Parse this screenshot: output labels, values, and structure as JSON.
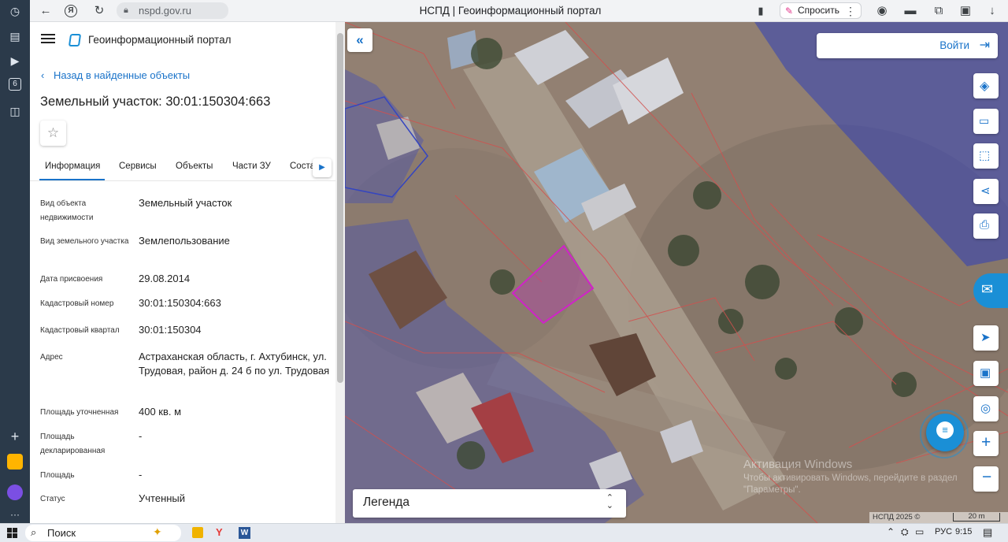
{
  "browser": {
    "url": "nspd.gov.ru",
    "tab_title": "НСПД | Геоинформационный портал",
    "ask_label": "Спросить",
    "rail_badge": "6"
  },
  "panel": {
    "portal_title": "Геоинформационный портал",
    "back_link": "Назад в найденные объекты",
    "object_title": "Земельный участок: 30:01:150304:663",
    "tabs": [
      "Информация",
      "Сервисы",
      "Объекты",
      "Части ЗУ",
      "Соста"
    ],
    "properties": [
      {
        "label": "Вид объекта недвижимости",
        "value": "Земельный участок"
      },
      {
        "label": "Вид земельного участка",
        "value": "Землепользование"
      },
      {
        "label": "Дата присвоения",
        "value": "29.08.2014"
      },
      {
        "label": "Кадастровый номер",
        "value": "30:01:150304:663"
      },
      {
        "label": "Кадастровый квартал",
        "value": "30:01:150304"
      },
      {
        "label": "Адрес",
        "value": "Астраханская область, г. Ахтубинск, ул. Трудовая, район д. 24 б по ул. Трудовая"
      },
      {
        "label": "Площадь уточненная",
        "value": "400 кв. м"
      },
      {
        "label": "Площадь декларированная",
        "value": "-"
      },
      {
        "label": "Площадь",
        "value": "-"
      },
      {
        "label": "Статус",
        "value": "Учтенный"
      }
    ]
  },
  "map": {
    "login_label": "Войти",
    "legend_label": "Легенда",
    "copyright": "НСПД 2025 ©",
    "scale_label": "20 m",
    "watermark_line1": "Активация Windows",
    "watermark_line2": "Чтобы активировать Windows, перейдите в раздел",
    "watermark_line3": "\"Параметры\"."
  },
  "taskbar": {
    "search_label": "Поиск",
    "lang": "РУС",
    "time": "9:15"
  }
}
